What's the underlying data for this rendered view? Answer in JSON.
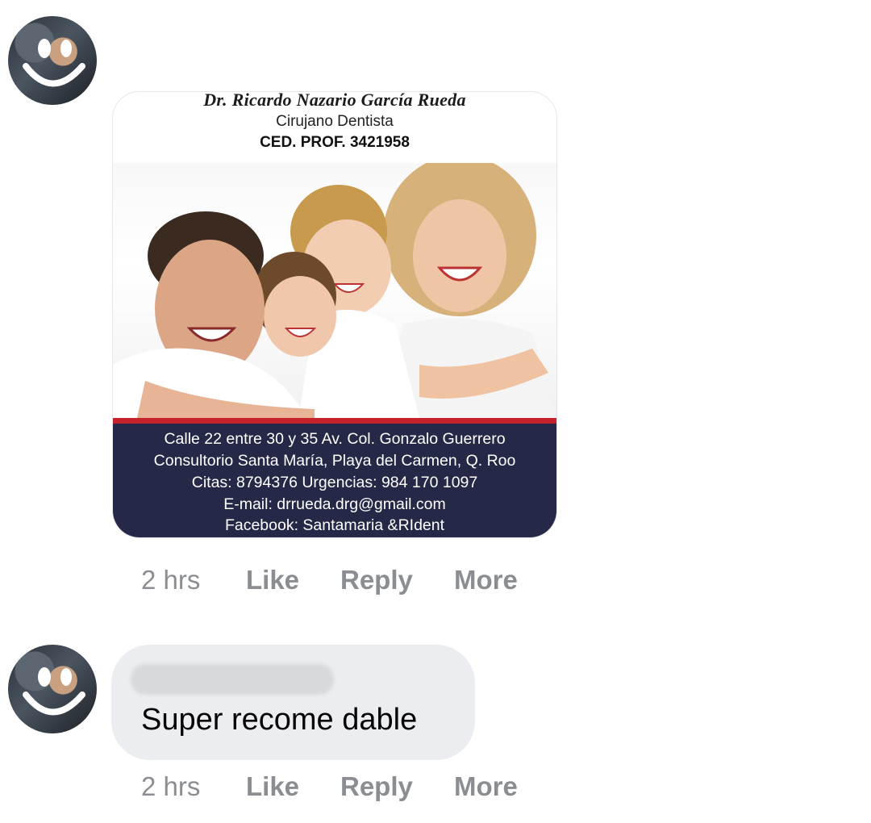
{
  "comments": [
    {
      "attachment": {
        "doctor_name": "Dr. Ricardo Nazario García Rueda",
        "specialty": "Cirujano Dentista",
        "license": "CED. PROF. 3421958",
        "address_line1": "Calle 22 entre 30 y 35 Av. Col. Gonzalo Guerrero",
        "address_line2": "Consultorio Santa María, Playa del Carmen, Q. Roo",
        "phones": "Citas: 8794376  Urgencias: 984 170 1097",
        "email": "E-mail: drrueda.drg@gmail.com",
        "facebook": "Facebook: Santamaria &RIdent"
      },
      "time": "2 hrs",
      "like_label": "Like",
      "reply_label": "Reply",
      "more_label": "More"
    },
    {
      "text": "Super recome dable",
      "time": "2 hrs",
      "like_label": "Like",
      "reply_label": "Reply",
      "more_label": "More"
    }
  ],
  "colors": {
    "meta_text": "#8a8d91",
    "bubble_bg": "#ebedf0",
    "ad_footer_bg": "#252846",
    "ad_accent_red": "#c4232e"
  }
}
